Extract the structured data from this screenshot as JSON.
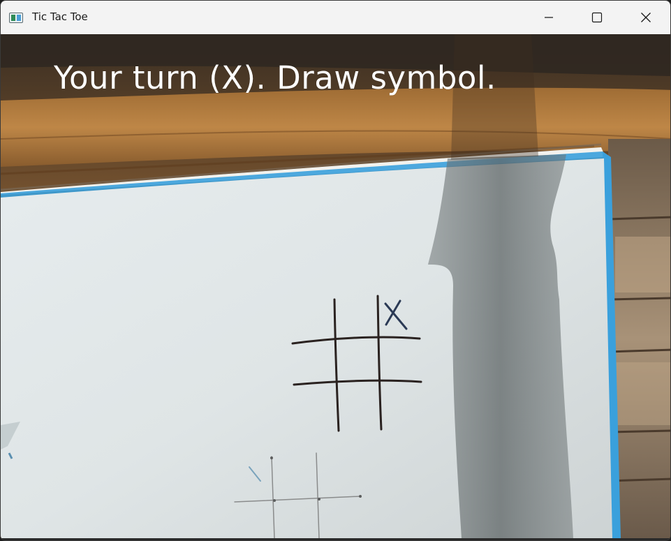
{
  "window": {
    "title": "Tic Tac Toe",
    "controls": {
      "minimize_icon": "minimize-icon",
      "maximize_icon": "maximize-icon",
      "close_icon": "close-icon"
    }
  },
  "feed": {
    "status_message": "Your turn (X). Draw symbol.",
    "board_marks": [
      {
        "row": 1,
        "col": 3,
        "symbol": "X"
      }
    ]
  },
  "colors": {
    "titlebar": "#f3f3f3",
    "overlay_text": "#ffffff",
    "board_edge": "#3aa0dc",
    "wood": "#9a6a32",
    "ink": "#1e1e1e",
    "x_mark": "#2b3a55"
  }
}
